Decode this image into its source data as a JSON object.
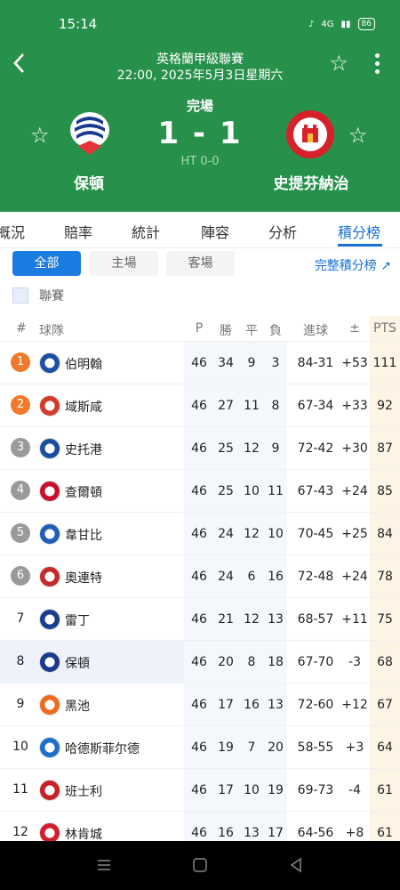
{
  "status": {
    "time": "15:14",
    "battery": "86",
    "signal_text": "4G"
  },
  "header": {
    "league": "英格蘭甲級聯賽",
    "datetime": "22:00, 2025年5月3日星期六",
    "match_status": "完場",
    "score": "1 - 1",
    "halftime": "HT 0-0",
    "home_team": "保頓",
    "away_team": "史提芬納治"
  },
  "tabs": [
    "概況",
    "賠率",
    "統計",
    "陣容",
    "分析",
    "積分榜"
  ],
  "filters": {
    "all": "全部",
    "home": "主場",
    "away": "客場",
    "full_link": "完整積分榜 ↗"
  },
  "league_label": "聯賽",
  "table": {
    "headers": {
      "rank": "#",
      "team": "球隊",
      "p": "P",
      "w": "勝",
      "d": "平",
      "l": "負",
      "goals": "進球",
      "gd": "±",
      "pts": "PTS"
    },
    "rows": [
      {
        "rank": "1",
        "team": "伯明翰",
        "p": "46",
        "w": "34",
        "d": "9",
        "l": "3",
        "goals": "84-31",
        "gd": "+53",
        "pts": "111"
      },
      {
        "rank": "2",
        "team": "域斯咸",
        "p": "46",
        "w": "27",
        "d": "11",
        "l": "8",
        "goals": "67-34",
        "gd": "+33",
        "pts": "92"
      },
      {
        "rank": "3",
        "team": "史托港",
        "p": "46",
        "w": "25",
        "d": "12",
        "l": "9",
        "goals": "72-42",
        "gd": "+30",
        "pts": "87"
      },
      {
        "rank": "4",
        "team": "查爾頓",
        "p": "46",
        "w": "25",
        "d": "10",
        "l": "11",
        "goals": "67-43",
        "gd": "+24",
        "pts": "85"
      },
      {
        "rank": "5",
        "team": "韋甘比",
        "p": "46",
        "w": "24",
        "d": "12",
        "l": "10",
        "goals": "70-45",
        "gd": "+25",
        "pts": "84"
      },
      {
        "rank": "6",
        "team": "奧連特",
        "p": "46",
        "w": "24",
        "d": "6",
        "l": "16",
        "goals": "72-48",
        "gd": "+24",
        "pts": "78"
      },
      {
        "rank": "7",
        "team": "雷丁",
        "p": "46",
        "w": "21",
        "d": "12",
        "l": "13",
        "goals": "68-57",
        "gd": "+11",
        "pts": "75"
      },
      {
        "rank": "8",
        "team": "保頓",
        "p": "46",
        "w": "20",
        "d": "8",
        "l": "18",
        "goals": "67-70",
        "gd": "-3",
        "pts": "68"
      },
      {
        "rank": "9",
        "team": "黑池",
        "p": "46",
        "w": "17",
        "d": "16",
        "l": "13",
        "goals": "72-60",
        "gd": "+12",
        "pts": "67"
      },
      {
        "rank": "10",
        "team": "哈德斯菲尔德",
        "p": "46",
        "w": "19",
        "d": "7",
        "l": "20",
        "goals": "58-55",
        "gd": "+3",
        "pts": "64"
      },
      {
        "rank": "11",
        "team": "班士利",
        "p": "46",
        "w": "17",
        "d": "10",
        "l": "19",
        "goals": "69-73",
        "gd": "-4",
        "pts": "61"
      },
      {
        "rank": "12",
        "team": "林肯城",
        "p": "46",
        "w": "16",
        "d": "13",
        "l": "17",
        "goals": "64-56",
        "gd": "+8",
        "pts": "61"
      }
    ]
  },
  "colors": {
    "header_green": "#27914b",
    "accent_blue": "#1a7be0",
    "badge_orange": "#f07a2a",
    "badge_grey": "#9a9a9a"
  }
}
